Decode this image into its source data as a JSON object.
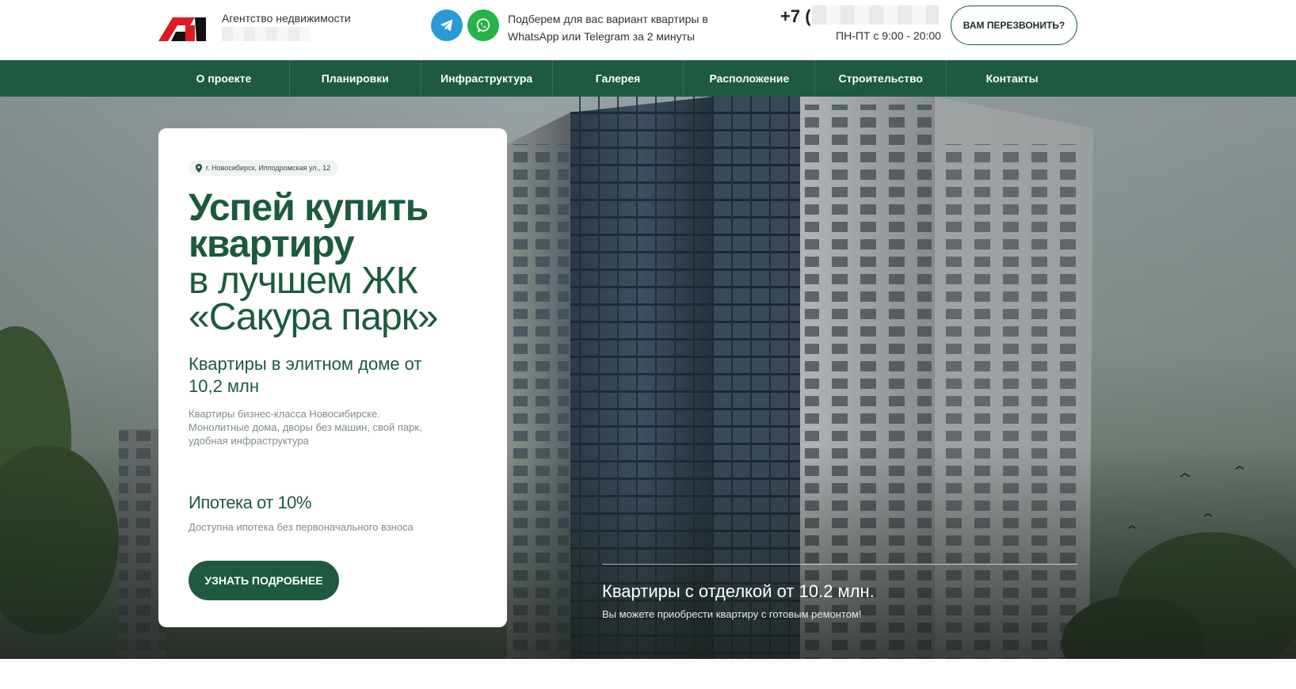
{
  "header": {
    "agency_label": "Агентство недвижимости",
    "messengers_text": "Подберем для вас вариант квартиры в WhatsApp или Telegram за 2 минуты",
    "telegram_icon": "telegram-icon",
    "whatsapp_icon": "whatsapp-icon",
    "phone_prefix": "+7 (",
    "hours": "ПН-ПТ с 9:00 - 20:00",
    "callback_label": "ВАМ ПЕРЕЗВОНИТЬ?"
  },
  "nav": {
    "items": [
      {
        "label": "О проекте"
      },
      {
        "label": "Планировки"
      },
      {
        "label": "Инфраструктура"
      },
      {
        "label": "Галерея"
      },
      {
        "label": "Расположение"
      },
      {
        "label": "Строительство"
      },
      {
        "label": "Контакты"
      }
    ]
  },
  "hero": {
    "address": "г. Новосибирск, Ипподромская ул., 12",
    "title_bold": "Успей купить квартиру",
    "title_light": "в лучшем ЖК «Сакура парк»",
    "subtitle": "Квартиры в элитном доме от 10,2 млн",
    "description": "Квартиры бизнес-класса Новосибирске. Монолитные дома, дворы без машин, свой парк, удобная инфраструктура",
    "mortgage_title": "Ипотека от 10%",
    "mortgage_note": "Доступна ипотека без первоначального взноса",
    "more_button": "УЗНАТЬ ПОДРОБНЕЕ",
    "promo_title": "Квартиры с отделкой от 10.2 млн.",
    "promo_subtitle": "Вы можете приобрести квартиру с готовым ремонтом!"
  },
  "colors": {
    "brand_green": "#1d5a3f",
    "telegram_blue": "#2a9ad6",
    "whatsapp_green": "#25b34a",
    "logo_red": "#e01a22"
  }
}
